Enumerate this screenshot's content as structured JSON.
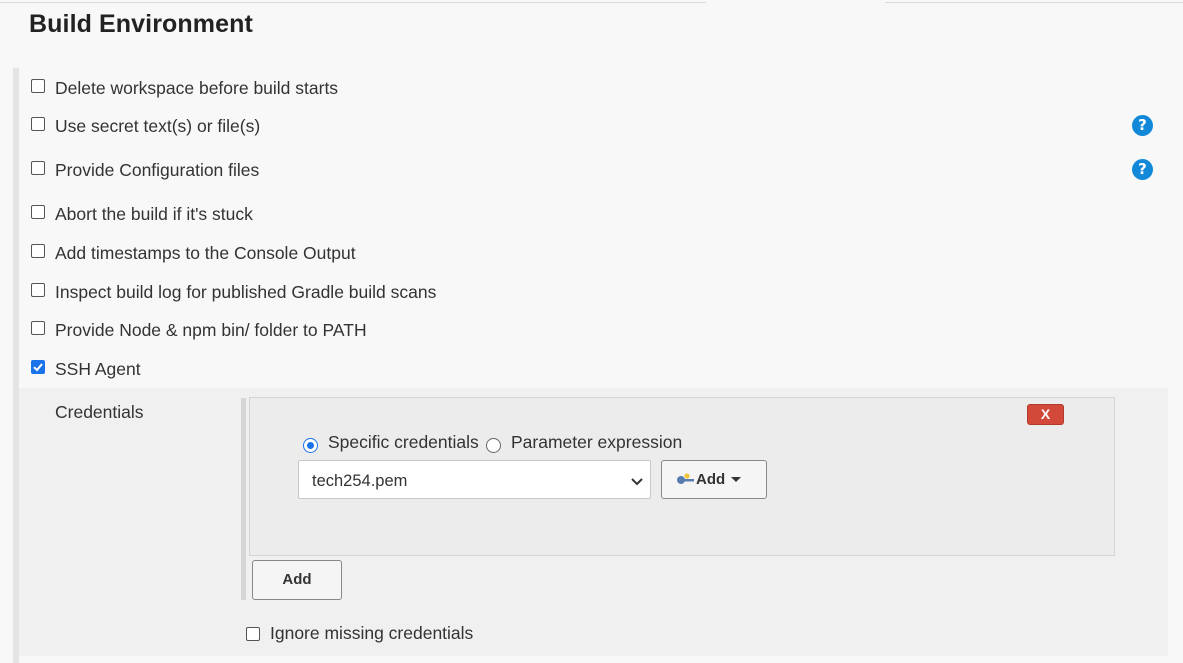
{
  "section": {
    "title": "Build Environment"
  },
  "options": [
    {
      "label": "Delete workspace before build starts",
      "checked": false,
      "help": false
    },
    {
      "label": "Use secret text(s) or file(s)",
      "checked": false,
      "help": true
    },
    {
      "label": "Provide Configuration files",
      "checked": false,
      "help": true
    },
    {
      "label": "Abort the build if it's stuck",
      "checked": false,
      "help": false
    },
    {
      "label": "Add timestamps to the Console Output",
      "checked": false,
      "help": false
    },
    {
      "label": "Inspect build log for published Gradle build scans",
      "checked": false,
      "help": false
    },
    {
      "label": "Provide Node & npm bin/ folder to PATH",
      "checked": false,
      "help": false
    },
    {
      "label": "SSH Agent",
      "checked": true,
      "help": false
    }
  ],
  "help_glyph": "?",
  "ssh_agent": {
    "credentials_label": "Credentials",
    "delete_label": "X",
    "radio_specific": "Specific credentials",
    "radio_parameter": "Parameter expression",
    "selected_radio": "specific",
    "selected_credential": "tech254.pem",
    "add_dropdown_label": "Add",
    "add_button_label": "Add",
    "ignore_missing_label": "Ignore missing credentials",
    "ignore_missing_checked": false
  },
  "colors": {
    "accent": "#1a73e8",
    "help": "#1289d8",
    "delete": "#d24939"
  },
  "icons": {
    "help": "question-circle-icon",
    "key": "key-icon",
    "dropdown": "chevron-down-icon"
  }
}
